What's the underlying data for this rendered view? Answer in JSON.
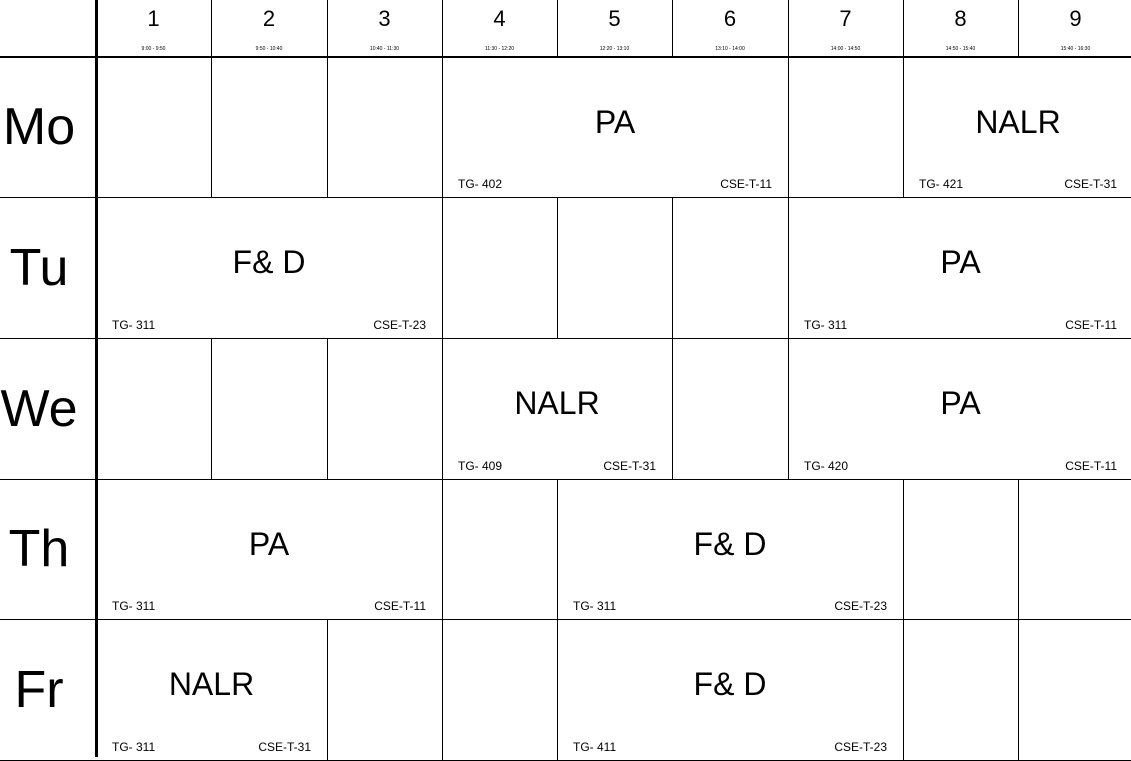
{
  "periods": [
    {
      "number": "1",
      "time": "9:00 - 9:50"
    },
    {
      "number": "2",
      "time": "9:50 - 10:40"
    },
    {
      "number": "3",
      "time": "10:40 - 11:30"
    },
    {
      "number": "4",
      "time": "11:30 - 12:20"
    },
    {
      "number": "5",
      "time": "12:20 - 13:10"
    },
    {
      "number": "6",
      "time": "13:10 - 14:00"
    },
    {
      "number": "7",
      "time": "14:00 - 14:50"
    },
    {
      "number": "8",
      "time": "14:50 - 15:40"
    },
    {
      "number": "9",
      "time": "15:40 - 16:30"
    }
  ],
  "days": [
    {
      "label": "Mo",
      "slots": [
        {
          "period": 1,
          "span": 1
        },
        {
          "period": 2,
          "span": 1
        },
        {
          "period": 3,
          "span": 1
        },
        {
          "period": 4,
          "span": 3,
          "subject": "PA",
          "room": "TG- 402",
          "group": "CSE-T-11"
        },
        {
          "period": 7,
          "span": 1
        },
        {
          "period": 8,
          "span": 2,
          "subject": "NALR",
          "room": "TG- 421",
          "group": "CSE-T-31"
        }
      ]
    },
    {
      "label": "Tu",
      "slots": [
        {
          "period": 1,
          "span": 3,
          "subject": "F& D",
          "room": "TG- 311",
          "group": "CSE-T-23"
        },
        {
          "period": 4,
          "span": 1
        },
        {
          "period": 5,
          "span": 1
        },
        {
          "period": 6,
          "span": 1
        },
        {
          "period": 7,
          "span": 3,
          "subject": "PA",
          "room": "TG- 311",
          "group": "CSE-T-11"
        }
      ]
    },
    {
      "label": "We",
      "slots": [
        {
          "period": 1,
          "span": 1
        },
        {
          "period": 2,
          "span": 1
        },
        {
          "period": 3,
          "span": 1
        },
        {
          "period": 4,
          "span": 2,
          "subject": "NALR",
          "room": "TG- 409",
          "group": "CSE-T-31"
        },
        {
          "period": 6,
          "span": 1
        },
        {
          "period": 7,
          "span": 3,
          "subject": "PA",
          "room": "TG- 420",
          "group": "CSE-T-11"
        }
      ]
    },
    {
      "label": "Th",
      "slots": [
        {
          "period": 1,
          "span": 3,
          "subject": "PA",
          "room": "TG- 311",
          "group": "CSE-T-11"
        },
        {
          "period": 4,
          "span": 1
        },
        {
          "period": 5,
          "span": 3,
          "subject": "F& D",
          "room": "TG- 311",
          "group": "CSE-T-23"
        },
        {
          "period": 8,
          "span": 1
        },
        {
          "period": 9,
          "span": 1
        }
      ]
    },
    {
      "label": "Fr",
      "slots": [
        {
          "period": 1,
          "span": 2,
          "subject": "NALR",
          "room": "TG- 311",
          "group": "CSE-T-31"
        },
        {
          "period": 3,
          "span": 1
        },
        {
          "period": 4,
          "span": 1
        },
        {
          "period": 5,
          "span": 3,
          "subject": "F& D",
          "room": "TG- 411",
          "group": "CSE-T-23"
        },
        {
          "period": 8,
          "span": 1
        },
        {
          "period": 9,
          "span": 1
        }
      ]
    }
  ]
}
